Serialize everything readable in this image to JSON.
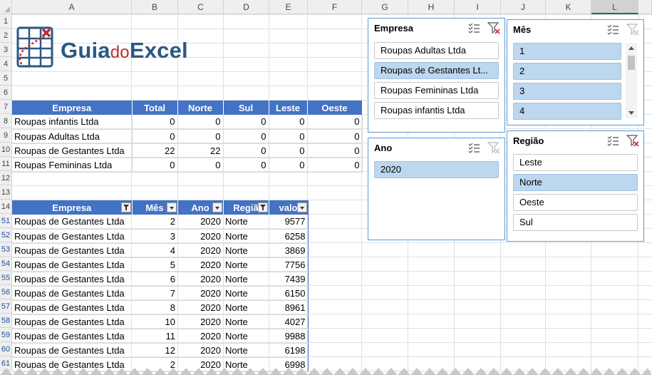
{
  "columns": [
    "A",
    "B",
    "C",
    "D",
    "E",
    "F",
    "G",
    "H",
    "I",
    "J",
    "K",
    "L"
  ],
  "selected_column": "L",
  "row_numbers": [
    "1",
    "2",
    "3",
    "4",
    "5",
    "6",
    "7",
    "8",
    "9",
    "10",
    "11",
    "12",
    "13",
    "14",
    "51",
    "52",
    "53",
    "54",
    "55",
    "56",
    "57",
    "58",
    "59",
    "60",
    "61"
  ],
  "logo": {
    "main": "Guia",
    "mid": "do",
    "end": "Excel"
  },
  "summary": {
    "headers": [
      "Empresa",
      "Total",
      "Norte",
      "Sul",
      "Leste",
      "Oeste"
    ],
    "rows": [
      [
        "Roupas infantis Ltda",
        "0",
        "0",
        "0",
        "0",
        "0"
      ],
      [
        "Roupas Adultas Ltda",
        "0",
        "0",
        "0",
        "0",
        "0"
      ],
      [
        "Roupas de Gestantes Ltda",
        "22",
        "22",
        "0",
        "0",
        "0"
      ],
      [
        "Roupas Femininas Ltda",
        "0",
        "0",
        "0",
        "0",
        "0"
      ]
    ]
  },
  "detail": {
    "headers": [
      "Empresa",
      "Mês",
      "Ano",
      "Regiã",
      "valo"
    ],
    "rows": [
      [
        "Roupas de Gestantes Ltda",
        "2",
        "2020",
        "Norte",
        "9577"
      ],
      [
        "Roupas de Gestantes Ltda",
        "3",
        "2020",
        "Norte",
        "6258"
      ],
      [
        "Roupas de Gestantes Ltda",
        "4",
        "2020",
        "Norte",
        "3869"
      ],
      [
        "Roupas de Gestantes Ltda",
        "5",
        "2020",
        "Norte",
        "7756"
      ],
      [
        "Roupas de Gestantes Ltda",
        "6",
        "2020",
        "Norte",
        "7439"
      ],
      [
        "Roupas de Gestantes Ltda",
        "7",
        "2020",
        "Norte",
        "6150"
      ],
      [
        "Roupas de Gestantes Ltda",
        "8",
        "2020",
        "Norte",
        "8961"
      ],
      [
        "Roupas de Gestantes Ltda",
        "10",
        "2020",
        "Norte",
        "4027"
      ],
      [
        "Roupas de Gestantes Ltda",
        "11",
        "2020",
        "Norte",
        "9988"
      ],
      [
        "Roupas de Gestantes Ltda",
        "12",
        "2020",
        "Norte",
        "6198"
      ],
      [
        "Roupas de Gestantes Ltda",
        "2",
        "2020",
        "Norte",
        "6998"
      ]
    ]
  },
  "slicers": {
    "empresa": {
      "title": "Empresa",
      "items": [
        "Roupas Adultas Ltda",
        "Roupas de Gestantes Lt...",
        "Roupas Femininas Ltda",
        "Roupas infantis Ltda"
      ],
      "selected": [
        1
      ]
    },
    "mes": {
      "title": "Mês",
      "items": [
        "1",
        "2",
        "3",
        "4"
      ],
      "selected": [
        0,
        1,
        2,
        3
      ]
    },
    "ano": {
      "title": "Ano",
      "items": [
        "2020"
      ],
      "selected": [
        0
      ]
    },
    "regiao": {
      "title": "Região",
      "items": [
        "Leste",
        "Norte",
        "Oeste",
        "Sul"
      ],
      "selected": [
        1
      ]
    }
  },
  "colors": {
    "header_blue": "#4472c4",
    "slicer_selected": "#bdd7ee",
    "slicer_border": "#5b9bd5",
    "logo_blue": "#2a5886",
    "logo_red": "#c42b2b"
  }
}
